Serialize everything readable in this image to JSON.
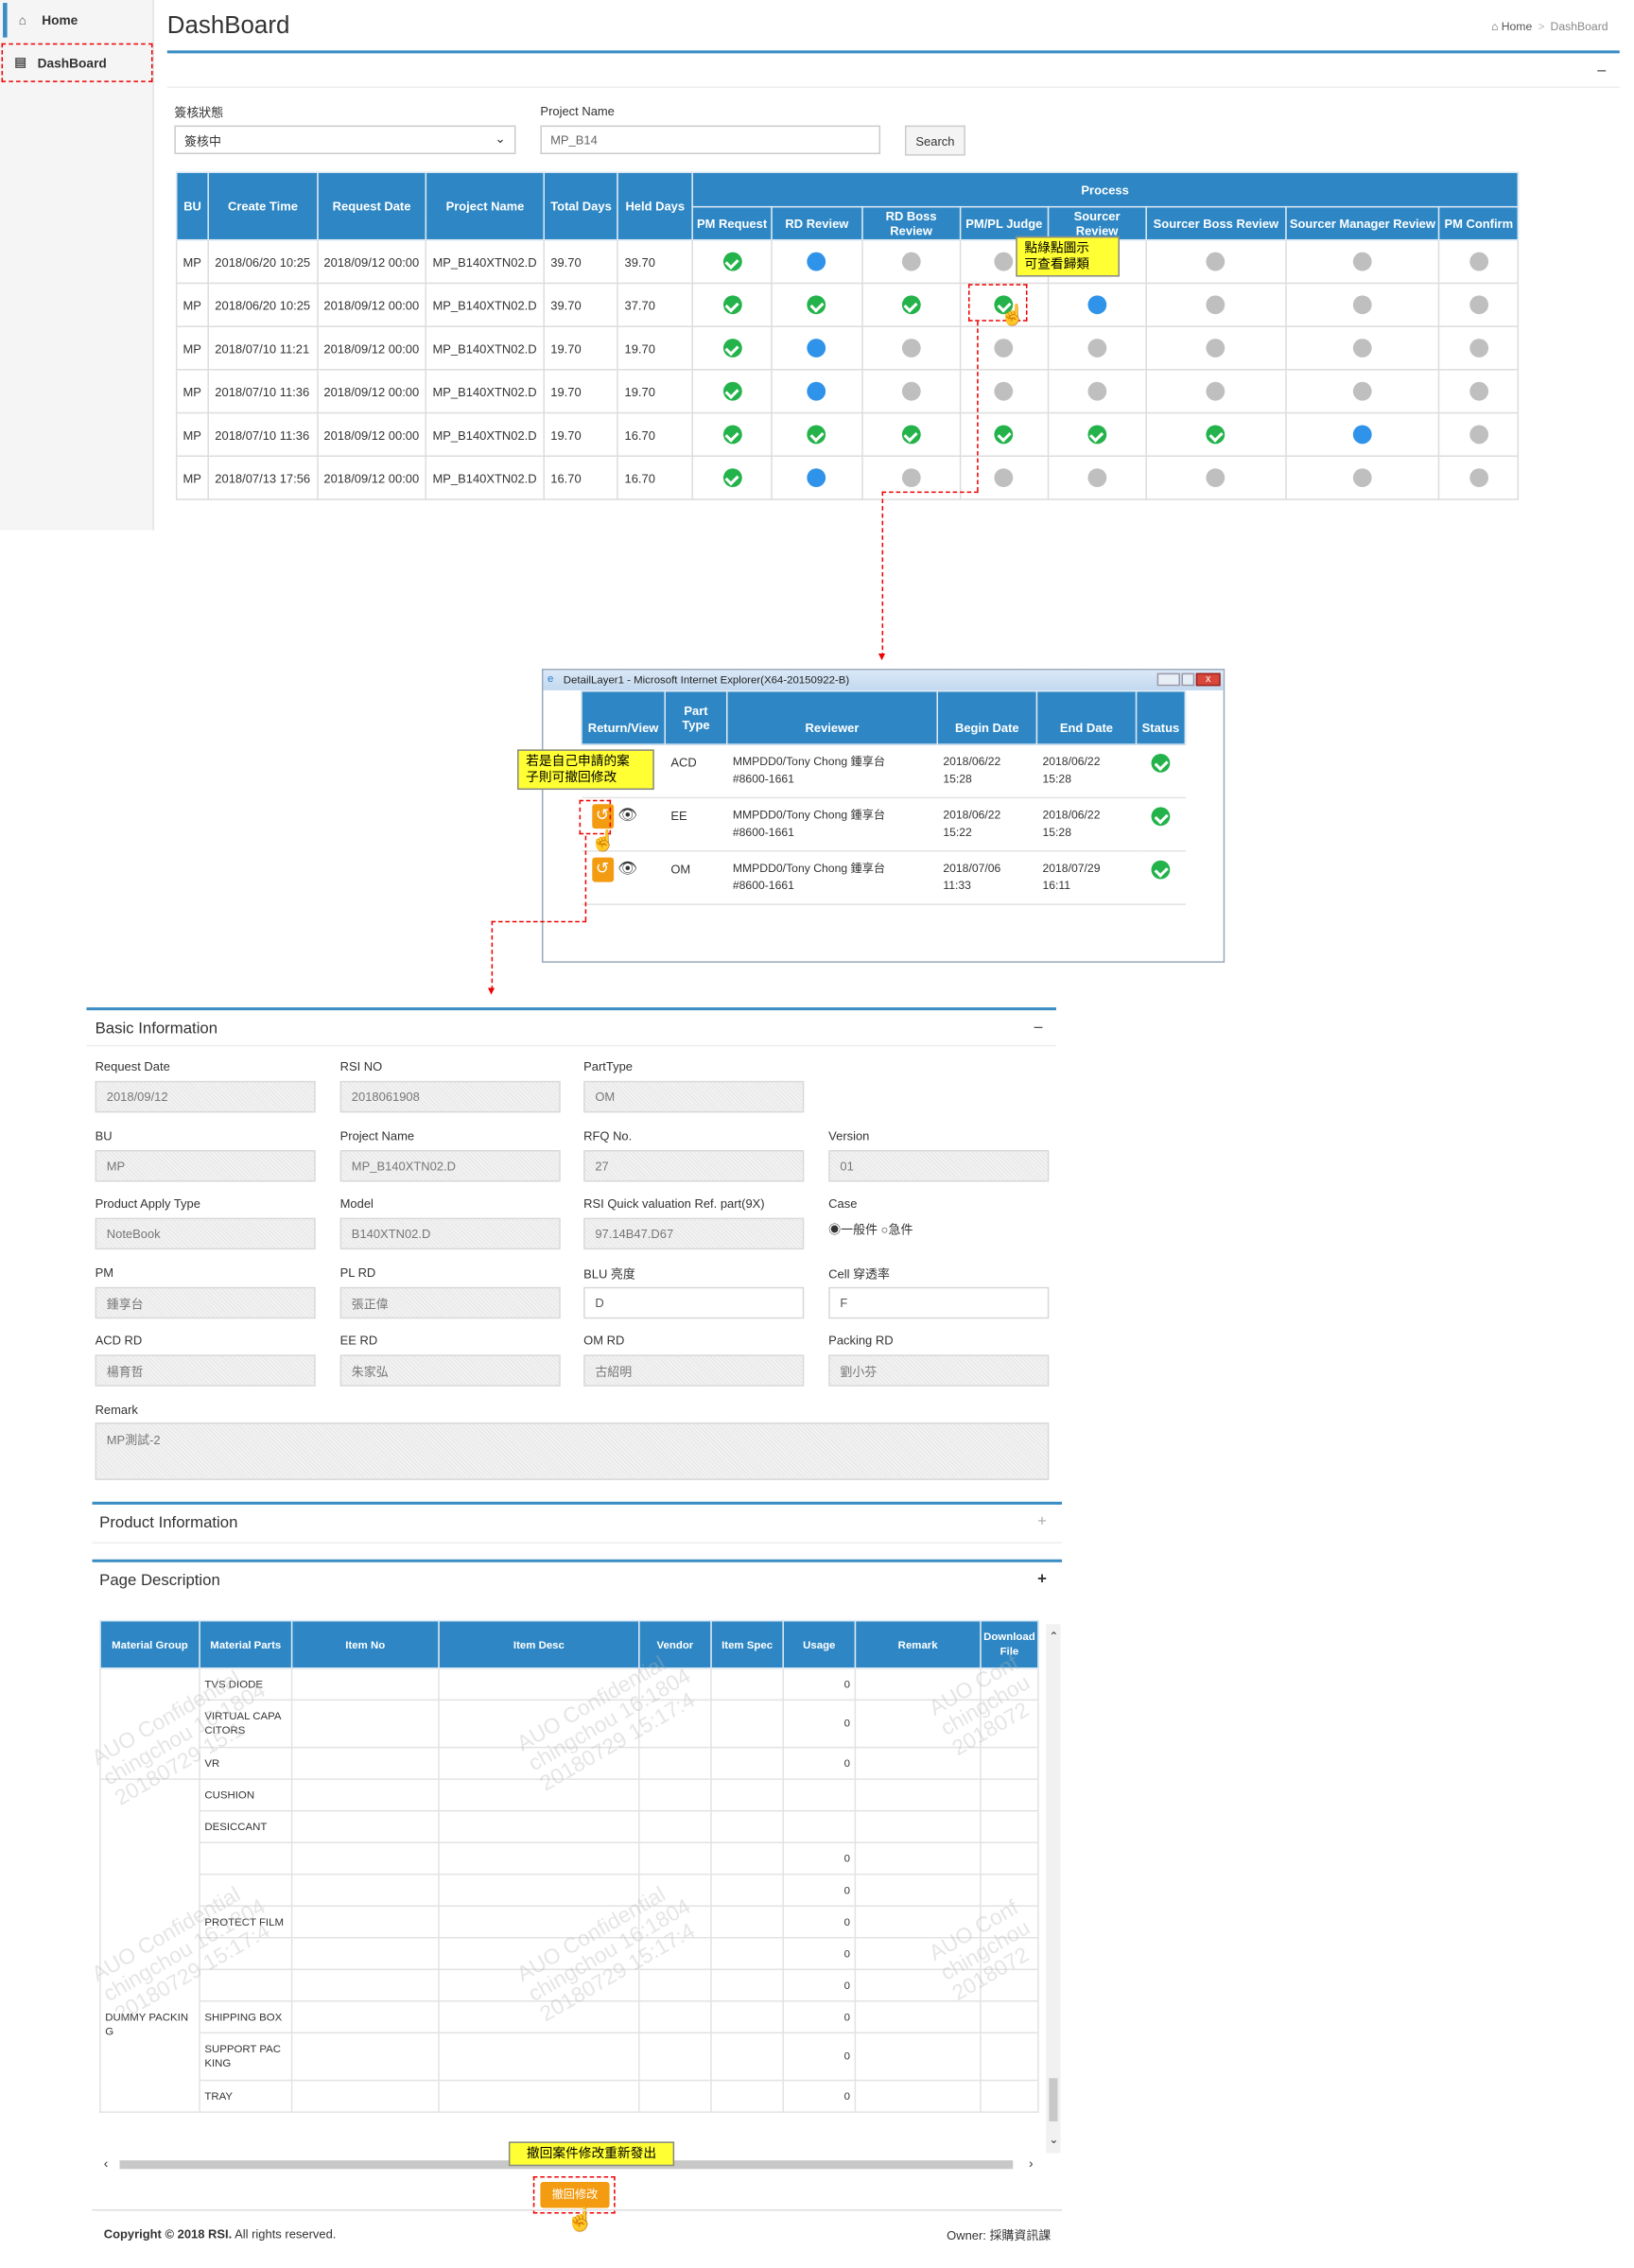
{
  "sidebar": {
    "items": [
      {
        "label": "Home",
        "icon": "home-icon"
      },
      {
        "label": "DashBoard",
        "icon": "file-icon"
      }
    ]
  },
  "header": {
    "title": "DashBoard",
    "breadcrumb": [
      "Home",
      "DashBoard"
    ]
  },
  "filters": {
    "status_label": "簽核狀態",
    "status_value": "簽核中",
    "project_label": "Project Name",
    "project_value": "MP_B14",
    "search_label": "Search"
  },
  "main_table": {
    "headers": [
      "BU",
      "Create Time",
      "Request Date",
      "Project Name",
      "Total Days",
      "Held Days"
    ],
    "process_header": "Process",
    "process_cols": [
      "PM Request",
      "RD Review",
      "RD Boss Review",
      "PM/PL Judge",
      "Sourcer Review",
      "Sourcer Boss Review",
      "Sourcer Manager Review",
      "PM Confirm"
    ],
    "rows": [
      {
        "bu": "MP",
        "create": "2018/06/20 10:25",
        "request": "2018/09/12 00:00",
        "project": "MP_B140XTN02.D",
        "total": "39.70",
        "held": "39.70",
        "status": [
          "done",
          "active",
          "pending",
          "pending",
          "",
          "pending",
          "pending",
          "pending"
        ]
      },
      {
        "bu": "MP",
        "create": "2018/06/20 10:25",
        "request": "2018/09/12 00:00",
        "project": "MP_B140XTN02.D",
        "total": "39.70",
        "held": "37.70",
        "status": [
          "done",
          "done",
          "done",
          "done",
          "active",
          "pending",
          "pending",
          "pending"
        ]
      },
      {
        "bu": "MP",
        "create": "2018/07/10 11:21",
        "request": "2018/09/12 00:00",
        "project": "MP_B140XTN02.D",
        "total": "19.70",
        "held": "19.70",
        "status": [
          "done",
          "active",
          "pending",
          "pending",
          "pending",
          "pending",
          "pending",
          "pending"
        ]
      },
      {
        "bu": "MP",
        "create": "2018/07/10 11:36",
        "request": "2018/09/12 00:00",
        "project": "MP_B140XTN02.D",
        "total": "19.70",
        "held": "19.70",
        "status": [
          "done",
          "active",
          "pending",
          "pending",
          "pending",
          "pending",
          "pending",
          "pending"
        ]
      },
      {
        "bu": "MP",
        "create": "2018/07/10 11:36",
        "request": "2018/09/12 00:00",
        "project": "MP_B140XTN02.D",
        "total": "19.70",
        "held": "16.70",
        "status": [
          "done",
          "done",
          "done",
          "done",
          "done",
          "done",
          "active",
          "pending"
        ]
      },
      {
        "bu": "MP",
        "create": "2018/07/13 17:56",
        "request": "2018/09/12 00:00",
        "project": "MP_B140XTN02.D",
        "total": "16.70",
        "held": "16.70",
        "status": [
          "done",
          "active",
          "pending",
          "pending",
          "pending",
          "pending",
          "pending",
          "pending"
        ]
      }
    ]
  },
  "notes": {
    "n1": "點綠點圖示\n可查看歸類",
    "n2": "若是自己申請的案\n子則可撤回修改",
    "n3": "撤回案件修改重新發出"
  },
  "popup": {
    "title": "DetailLayer1 - Microsoft Internet Explorer(X64-20150922-B)",
    "headers": [
      "Return/View",
      "Part Type",
      "Reviewer",
      "Begin Date",
      "End Date",
      "Status"
    ],
    "rows": [
      {
        "part": "ACD",
        "reviewer": "MMPDD0/Tony Chong 鍾享台\n#8600-1661",
        "begin": "2018/06/22\n15:28",
        "end": "2018/06/22\n15:28"
      },
      {
        "part": "EE",
        "reviewer": "MMPDD0/Tony Chong 鍾享台\n#8600-1661",
        "begin": "2018/06/22\n15:22",
        "end": "2018/06/22\n15:28"
      },
      {
        "part": "OM",
        "reviewer": "MMPDD0/Tony Chong 鍾享台\n#8600-1661",
        "begin": "2018/07/06\n11:33",
        "end": "2018/07/29\n16:11"
      }
    ]
  },
  "basic": {
    "title": "Basic Information",
    "fields": [
      {
        "label": "Request Date",
        "value": "2018/09/12"
      },
      {
        "label": "RSI NO",
        "value": "2018061908"
      },
      {
        "label": "PartType",
        "value": "OM"
      },
      {
        "label": "BU",
        "value": "MP"
      },
      {
        "label": "Project Name",
        "value": "MP_B140XTN02.D"
      },
      {
        "label": "RFQ No.",
        "value": "27"
      },
      {
        "label": "Version",
        "value": "01"
      },
      {
        "label": "Product Apply Type",
        "value": "NoteBook"
      },
      {
        "label": "Model",
        "value": "B140XTN02.D"
      },
      {
        "label": "RSI Quick valuation Ref. part(9X)",
        "value": "97.14B47.D67"
      },
      {
        "label": "Case",
        "value": ""
      },
      {
        "label": "PM",
        "value": "鍾享台"
      },
      {
        "label": "PL RD",
        "value": "張正偉"
      },
      {
        "label": "BLU 亮度",
        "value": "D"
      },
      {
        "label": "Cell 穿透率",
        "value": "F"
      },
      {
        "label": "ACD RD",
        "value": "楊育哲"
      },
      {
        "label": "EE RD",
        "value": "朱家弘"
      },
      {
        "label": "OM RD",
        "value": "古紹明"
      },
      {
        "label": "Packing RD",
        "value": "劉小芬"
      }
    ],
    "case_opt1": "一般件",
    "case_opt2": "急件",
    "remark_label": "Remark",
    "remark_value": "MP測試-2"
  },
  "product_title": "Product Information",
  "pagedesc": {
    "title": "Page Description",
    "headers": [
      "Material Group",
      "Material Parts",
      "Item No",
      "Item Desc",
      "Vendor",
      "Item Spec",
      "Usage",
      "Remark",
      "Download File"
    ],
    "group": "DUMMY PACKIN\nG",
    "rows": [
      {
        "part": "TVS DIODE",
        "usage": "0"
      },
      {
        "part": "VIRTUAL CAPA\nCITORS",
        "usage": "0"
      },
      {
        "part": "VR",
        "usage": "0"
      },
      {
        "part": "CUSHION",
        "usage": ""
      },
      {
        "part": "DESICCANT",
        "usage": ""
      },
      {
        "part": "",
        "usage": "0"
      },
      {
        "part": "",
        "usage": "0"
      },
      {
        "part": "PROTECT FILM",
        "usage": "0"
      },
      {
        "part": "",
        "usage": "0"
      },
      {
        "part": "",
        "usage": "0"
      },
      {
        "part": "SHIPPING BOX",
        "usage": "0"
      },
      {
        "part": "SUPPORT PAC\nKING",
        "usage": "0"
      },
      {
        "part": "TRAY",
        "usage": "0"
      }
    ]
  },
  "withdraw_button": "撤回修改",
  "footer": {
    "copyright": "Copyright © 2018 RSI.",
    "rights": " All rights reserved.",
    "owner": "Owner: 採購資訊課"
  }
}
